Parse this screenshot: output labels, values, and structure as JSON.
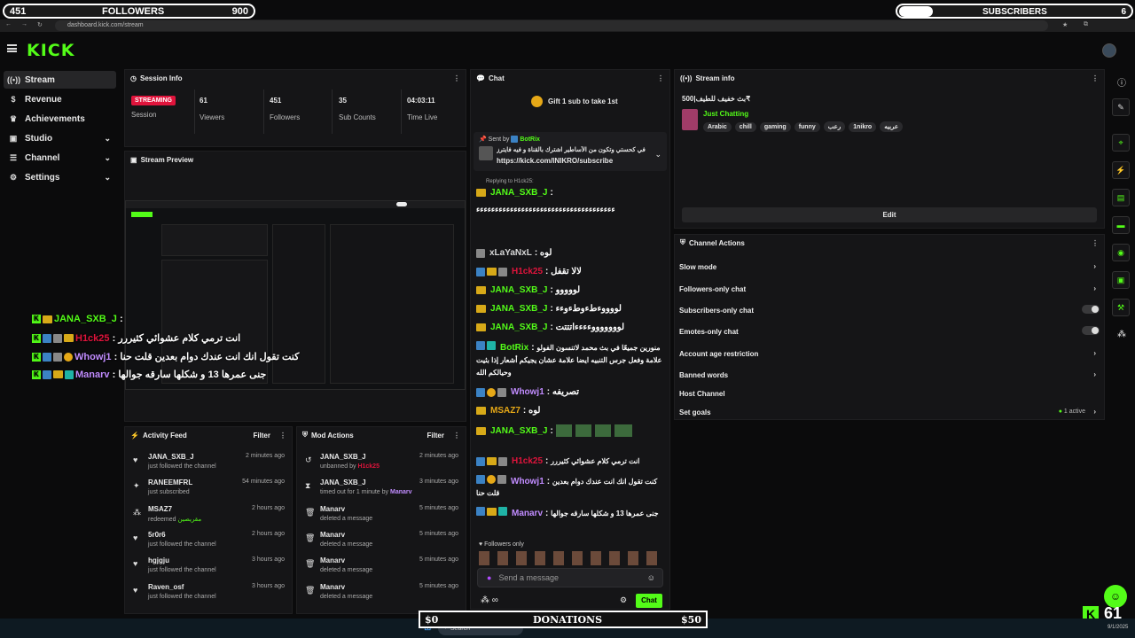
{
  "overlay": {
    "followers_current": "451",
    "followers_label": "FOLLOWERS",
    "followers_goal": "900",
    "subs_label": "SUBSCRIBERS",
    "subs_goal": "6",
    "donations_label": "DONATIONS",
    "donations_current": "$0",
    "donations_goal": "$50",
    "kick_viewer_count": "61"
  },
  "browser": {
    "url": "dashboard.kick.com/stream",
    "date": "9/1/2025"
  },
  "header": {
    "logo": "KICK"
  },
  "sidebar": {
    "items": [
      {
        "label": "Stream",
        "icon": "stream-icon"
      },
      {
        "label": "Revenue",
        "icon": "dollar-icon"
      },
      {
        "label": "Achievements",
        "icon": "trophy-icon"
      },
      {
        "label": "Studio",
        "icon": "studio-icon"
      },
      {
        "label": "Channel",
        "icon": "channel-icon"
      },
      {
        "label": "Settings",
        "icon": "gear-icon"
      }
    ]
  },
  "session": {
    "title": "Session Info",
    "status": "STREAMING",
    "session_label": "Session",
    "viewers": "61",
    "viewers_label": "Viewers",
    "followers": "451",
    "followers_label": "Followers",
    "subs": "35",
    "subs_label": "Sub Counts",
    "time": "04:03:11",
    "time_label": "Time Live"
  },
  "preview": {
    "title": "Stream Preview"
  },
  "overlay_chat": [
    {
      "user": "JANA_SXB_J",
      "text": ""
    },
    {
      "user": "H1ck25",
      "text": "انت ترمي كلام عشوائي كثيررر"
    },
    {
      "user": "Whowj1",
      "text": "كنت تقول انك انت عندك دوام بعدين قلت حنا"
    },
    {
      "user": "Manarv",
      "text": "جنى عمرها 13 و شكلها سارقه جوالها"
    }
  ],
  "activity": {
    "title": "Activity Feed",
    "filter": "Filter",
    "items": [
      {
        "name": "JANA_SXB_J",
        "desc": "just followed the channel",
        "time": "2 minutes ago"
      },
      {
        "name": "RANEEMFRL",
        "desc": "just subscribed",
        "time": "54 minutes ago"
      },
      {
        "name": "MSAZ7",
        "desc": "redeemed",
        "extra": "مقريصين",
        "time": "2 hours ago"
      },
      {
        "name": "5r0r6",
        "desc": "just followed the channel",
        "time": "2 hours ago"
      },
      {
        "name": "hgjgju",
        "desc": "just followed the channel",
        "time": "3 hours ago"
      },
      {
        "name": "Raven_osf",
        "desc": "just followed the channel",
        "time": "3 hours ago"
      }
    ]
  },
  "mod": {
    "title": "Mod Actions",
    "filter": "Filter",
    "items": [
      {
        "name": "JANA_SXB_J",
        "desc": "unbanned by",
        "by": "H1ck25",
        "time": "2 minutes ago"
      },
      {
        "name": "JANA_SXB_J",
        "desc": "timed out for 1 minute by",
        "by": "Manarv",
        "time": "3 minutes ago"
      },
      {
        "name": "Manarv",
        "desc": "deleted a message",
        "by": "",
        "time": "5 minutes ago"
      },
      {
        "name": "Manarv",
        "desc": "deleted a message",
        "by": "",
        "time": "5 minutes ago"
      },
      {
        "name": "Manarv",
        "desc": "deleted a message",
        "by": "",
        "time": "5 minutes ago"
      },
      {
        "name": "Manarv",
        "desc": "deleted a message",
        "by": "",
        "time": "5 minutes ago"
      }
    ]
  },
  "chat": {
    "title": "Chat",
    "gift_text": "Gift 1 sub to take 1st",
    "pinned_sent_by": "Sent by",
    "pinned_user": "BotRix",
    "pinned_text": "انا في كحستي وتكون من الأساطير اشترك بالقناة و فيه فايترز",
    "pinned_link": "https://kick.com/INIKRO/subscribe",
    "replying": "Replying to H1ck25:",
    "messages": [
      {
        "user": "JANA_SXB_J",
        "color": "#53fc18",
        "text": ""
      },
      {
        "user": "",
        "color": "#ffffff",
        "text": "ءءءءءءءءءءءءءءءءءءءءءءءءءءءءءءءءءءءءء"
      },
      {
        "user": "xLaYaNxL",
        "color": "#d8d8d8",
        "text": "لوه"
      },
      {
        "user": "H1ck25",
        "color": "#e0143c",
        "text": "لالا تقفل"
      },
      {
        "user": "JANA_SXB_J",
        "color": "#53fc18",
        "text": "لووووو"
      },
      {
        "user": "JANA_SXB_J",
        "color": "#53fc18",
        "text": "لووووءطءوطءوءء"
      },
      {
        "user": "JANA_SXB_J",
        "color": "#53fc18",
        "text": "لوووووووءءءءاتتتت"
      },
      {
        "user": "BotRix",
        "color": "#53fc18",
        "text": "منورين جميعًا في بث محمد لاتنسون الفولو علامة وفعل جرس التنبيه ايضا علامة عشان يجيكم أشعار إذا بثيت وحيالكم الله"
      },
      {
        "user": "Whowj1",
        "color": "#c18cff",
        "text": "تصريفه"
      },
      {
        "user": "MSAZ7",
        "color": "#e6a817",
        "text": "لوه"
      },
      {
        "user": "JANA_SXB_J",
        "color": "#53fc18",
        "text": ""
      },
      {
        "user": "H1ck25",
        "color": "#e0143c",
        "text": "انت ترمي كلام عشوائي كثيررر"
      },
      {
        "user": "Whowj1",
        "color": "#c18cff",
        "text": "كنت تقول انك انت عندك دوام بعدين قلت حنا"
      },
      {
        "user": "Manarv",
        "color": "#c18cff",
        "text": "جنى عمرها 13 و شكلها سارقه جوالها"
      }
    ],
    "followers_only": "Followers only",
    "input_placeholder": "Send a message",
    "send_label": "Chat",
    "infinity": "∞"
  },
  "stream_info": {
    "title": "Stream info",
    "stream_title": "بث خفيف للطيف|500₹",
    "category": "Just Chatting",
    "tags": [
      "Arabic",
      "chill",
      "gaming",
      "funny",
      "رعب",
      "1nikro",
      "عربيه"
    ],
    "edit_label": "Edit"
  },
  "channel_actions": {
    "title": "Channel Actions",
    "items": [
      {
        "label": "Slow mode",
        "control": "chevron"
      },
      {
        "label": "Followers-only chat",
        "control": "chevron"
      },
      {
        "label": "Subscribers-only chat",
        "control": "toggle"
      },
      {
        "label": "Emotes-only chat",
        "control": "toggle"
      },
      {
        "label": "Account age restriction",
        "control": "chevron"
      },
      {
        "label": "Banned words",
        "control": "chevron"
      },
      {
        "label": "Host Channel",
        "control": "none"
      },
      {
        "label": "Set goals",
        "control": "chevron",
        "status": "1 active"
      }
    ]
  },
  "taskbar": {
    "search": "Search"
  }
}
